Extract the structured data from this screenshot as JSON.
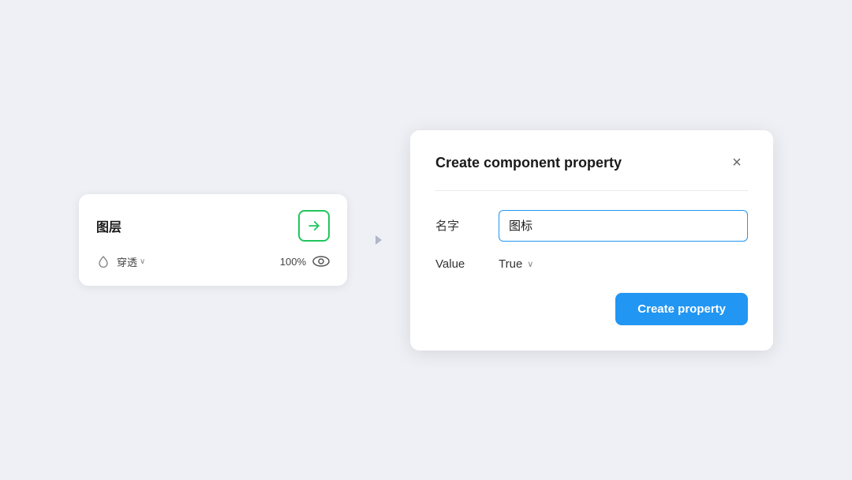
{
  "page": {
    "background_color": "#eef0f5"
  },
  "layer_card": {
    "title": "图层",
    "blend_mode": "穿透",
    "opacity": "100%",
    "link_icon_label": "link-icon"
  },
  "arrow": {
    "symbol": "▶"
  },
  "dialog": {
    "title": "Create component property",
    "close_label": "×",
    "name_label": "名字",
    "name_value": "图标",
    "value_label": "Value",
    "value_current": "True",
    "create_button_label": "Create property"
  }
}
